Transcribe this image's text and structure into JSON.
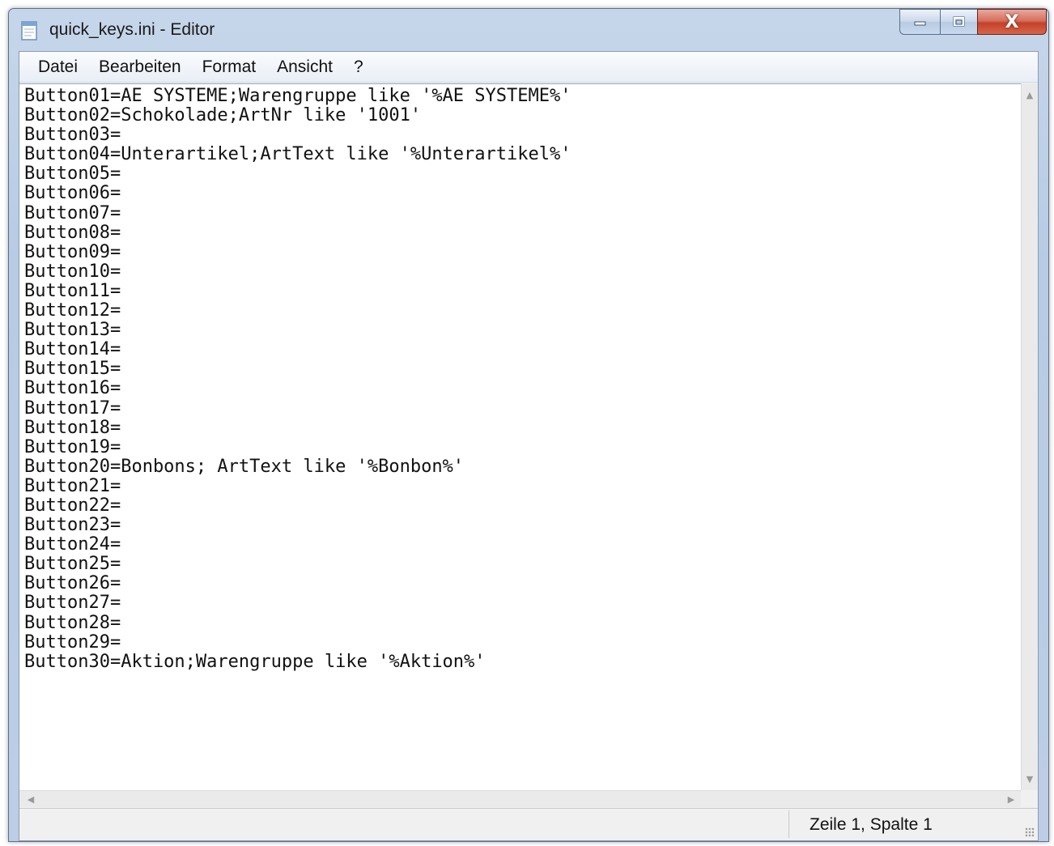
{
  "window": {
    "title": "quick_keys.ini - Editor",
    "app_icon": "notepad-icon",
    "caption_buttons": {
      "minimize_icon": "minimize-icon",
      "maximize_icon": "maximize-icon",
      "close_icon": "close-icon",
      "close_glyph": "X"
    }
  },
  "menu": {
    "items": [
      "Datei",
      "Bearbeiten",
      "Format",
      "Ansicht",
      "?"
    ]
  },
  "editor": {
    "content": "Button01=AE SYSTEME;Warengruppe like '%AE SYSTEME%'\nButton02=Schokolade;ArtNr like '1001'\nButton03=\nButton04=Unterartikel;ArtText like '%Unterartikel%'\nButton05=\nButton06=\nButton07=\nButton08=\nButton09=\nButton10=\nButton11=\nButton12=\nButton13=\nButton14=\nButton15=\nButton16=\nButton17=\nButton18=\nButton19=\nButton20=Bonbons; ArtText like '%Bonbon%'\nButton21=\nButton22=\nButton23=\nButton24=\nButton25=\nButton26=\nButton27=\nButton28=\nButton29=\nButton30=Aktion;Warengruppe like '%Aktion%'"
  },
  "statusbar": {
    "position": "Zeile 1, Spalte 1"
  },
  "colors": {
    "frame": "#bccde5",
    "close_button": "#c4412a",
    "editor_background": "#ffffff"
  }
}
